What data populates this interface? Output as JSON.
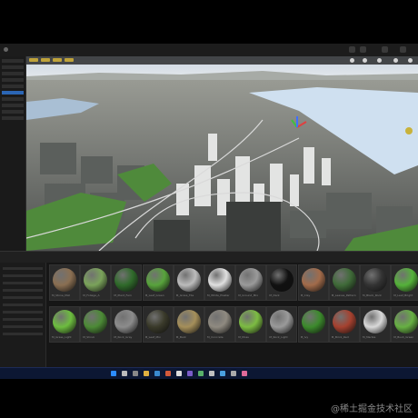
{
  "viewport": {
    "scene": "city aerial view with river"
  },
  "materials": [
    {
      "name": "M_Stone_Mat",
      "color": "#8a6f52"
    },
    {
      "name": "M_Foliage_A",
      "color": "#7aa35a"
    },
    {
      "name": "M_Plant_Fern",
      "color": "#2f6a2a"
    },
    {
      "name": "M_Leaf_Green",
      "color": "#58a33c"
    },
    {
      "name": "M_Grass_Tile",
      "color": "#bcbcbc"
    },
    {
      "name": "M_White_Plaster",
      "color": "#e0e0e0"
    },
    {
      "name": "M_Ground_Mix",
      "color": "#9a9a9a"
    },
    {
      "name": "M_Dark",
      "color": "#111111"
    },
    {
      "name": "M_Clay",
      "color": "#a26b4a"
    },
    {
      "name": "M_Leaves_Pattern",
      "color": "#3f6a38"
    },
    {
      "name": "M_Black_Rock",
      "color": "#333333"
    },
    {
      "name": "M_Leaf_Bright",
      "color": "#55b23a"
    },
    {
      "name": "M_Grass_Light",
      "color": "#6dbd3f"
    },
    {
      "name": "M_Shrub",
      "color": "#4c8a36"
    },
    {
      "name": "M_Rock_Gray",
      "color": "#8c8c8c"
    },
    {
      "name": "M_Leaf_Mix",
      "color": "#3a3a2a"
    },
    {
      "name": "M_Bark",
      "color": "#a58f5a"
    },
    {
      "name": "M_Concrete",
      "color": "#8f8a80"
    },
    {
      "name": "M_Moss",
      "color": "#7cbc42"
    },
    {
      "name": "M_Rock_Light",
      "color": "#9a9a9a"
    },
    {
      "name": "M_Ivy",
      "color": "#3c8a2c"
    },
    {
      "name": "M_Brick_Red",
      "color": "#a5412f"
    },
    {
      "name": "M_Marble",
      "color": "#d9d9d9"
    },
    {
      "name": "M_Bush_Green",
      "color": "#67b043"
    }
  ],
  "watermark": "@稀土掘金技术社区"
}
